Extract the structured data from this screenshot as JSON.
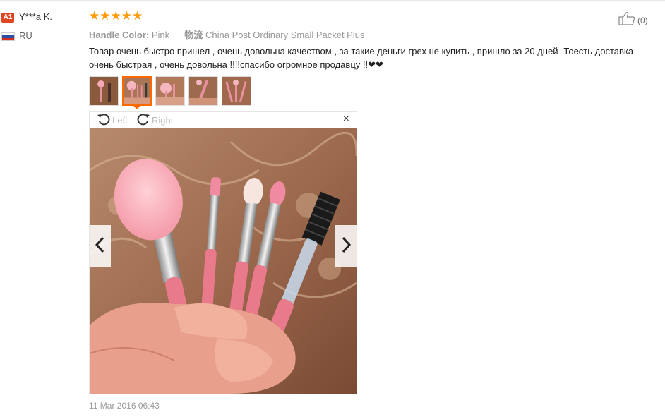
{
  "user": {
    "badge": "A1",
    "name": "Y***a K.",
    "country": "RU"
  },
  "review": {
    "stars": "★★★★★",
    "rating": 5,
    "property_label": "Handle Color:",
    "property_value": "Pink",
    "logistics_label": "物流",
    "logistics_value": "China Post Ordinary Small Packet Plus",
    "text": "Товар очень быстро пришел , очень довольна качеством , за такие деньги грех не купить , пришло за 20 дней -Тоесть доставка очень быстрая , очень довольна !!!!спасибо огромное продавцу !!❤❤",
    "date": "11 Mar 2016 06:43"
  },
  "helpful": {
    "count": "(0)"
  },
  "viewer": {
    "rotate_left": "Left",
    "rotate_right": "Right",
    "close": "×"
  },
  "thumbnails": {
    "count": 5,
    "active_index": 1
  },
  "colors": {
    "accent": "#ff6a00",
    "star": "#ff9900",
    "badge": "#e0461f"
  }
}
